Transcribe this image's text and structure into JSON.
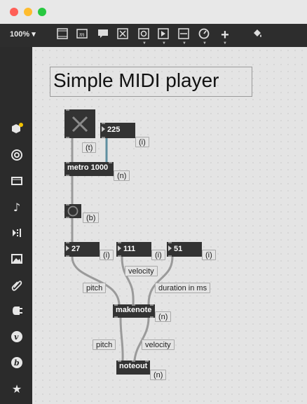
{
  "toolbar": {
    "zoom_label": "100% ▾"
  },
  "patch": {
    "title": "Simple MIDI player",
    "toggle_arg": "(t)",
    "tempo_value": "225",
    "tempo_arg": "(i)",
    "metro_text": "metro 1000",
    "metro_arg": "(n)",
    "bang_arg": "(b)",
    "pitch_value": "27",
    "pitch_arg": "(i)",
    "velocity_value": "111",
    "velocity_arg": "(i)",
    "duration_value": "51",
    "duration_arg": "(i)",
    "velocity_hint": "velocity",
    "pitch_hint": "pitch",
    "duration_hint": "duration in ms",
    "makenote_text": "makenote",
    "makenote_arg": "(n)",
    "pitch_hint2": "pitch",
    "velocity_hint2": "velocity",
    "noteout_text": "noteout",
    "noteout_arg": "(n)"
  },
  "sidebar_icons": [
    "packages-icon",
    "target-icon",
    "video-icon",
    "music-note-icon",
    "audio-steps-icon",
    "image-icon",
    "paperclip-icon",
    "plug-icon",
    "v-icon",
    "b-icon",
    "star-icon"
  ],
  "colors": {
    "toolbar": "#2d2d2d",
    "object": "#333333",
    "cord": "#a9a9a9"
  }
}
